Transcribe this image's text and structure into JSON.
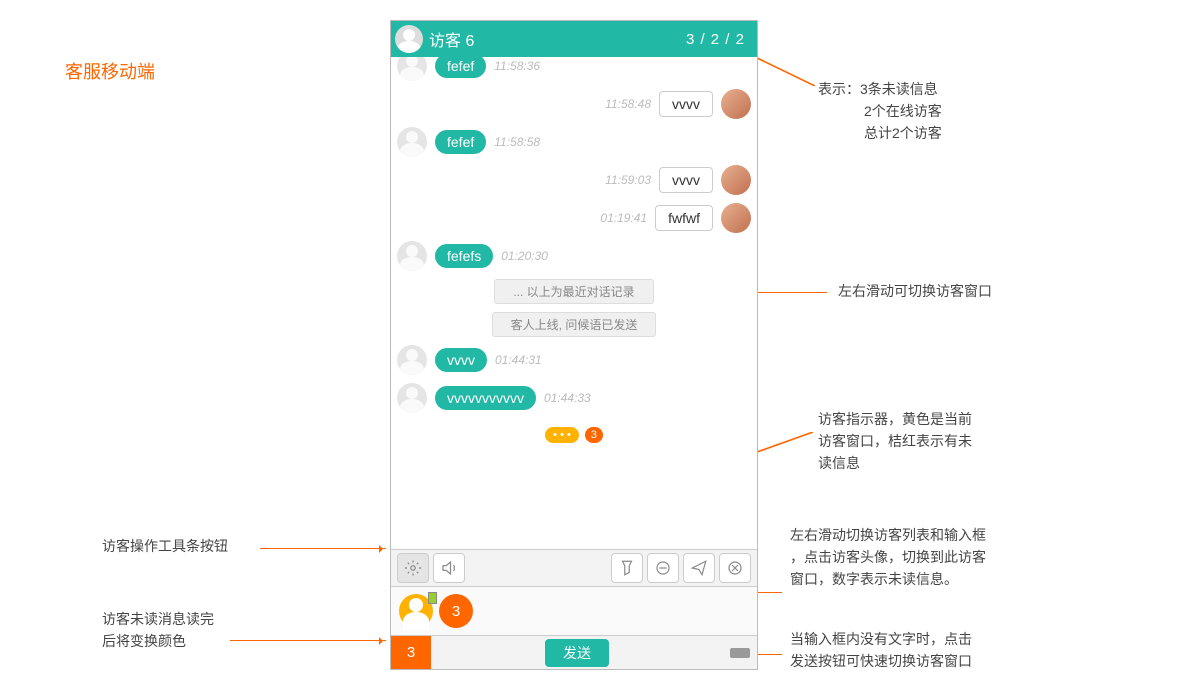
{
  "page_title": "客服移动端",
  "header": {
    "visitor_name": "访客 6",
    "counts": "3 / 2 / 2"
  },
  "messages": [
    {
      "side": "left",
      "text": "fefef",
      "ts": "11:58:36",
      "plain": false
    },
    {
      "side": "right",
      "text": "vvvv",
      "ts": "11:58:48",
      "plain": true
    },
    {
      "side": "left",
      "text": "fefef",
      "ts": "11:58:58",
      "plain": false
    },
    {
      "side": "right",
      "text": "vvvv",
      "ts": "11:59:03",
      "plain": true
    },
    {
      "side": "right",
      "text": "fwfwf",
      "ts": "01:19:41",
      "plain": true
    },
    {
      "side": "left",
      "text": "fefefs",
      "ts": "01:20:30",
      "plain": false
    },
    {
      "sys": "... 以上为最近对话记录"
    },
    {
      "sys": "客人上线, 问候语已发送"
    },
    {
      "side": "left",
      "text": "vvvv",
      "ts": "01:44:31",
      "plain": false
    },
    {
      "side": "left",
      "text": "vvvvvvvvvvv",
      "ts": "01:44:33",
      "plain": false
    }
  ],
  "indicator": {
    "dot": "• • •",
    "badge": "3"
  },
  "visitor_strip": {
    "orange_badge": "3"
  },
  "bottom": {
    "badge": "3",
    "send_label": "发送"
  },
  "annotations": {
    "counts_explain_l1": "表示：3条未读信息",
    "counts_explain_l2": "2个在线访客",
    "counts_explain_l3": "总计2个访客",
    "swipe": "左右滑动可切换访客窗口",
    "indicator_l1": "访客指示器，黄色是当前",
    "indicator_l2": "访客窗口，桔红表示有未",
    "indicator_l3": "读信息",
    "toolbar_label": "访客操作工具条按钮",
    "strip_l1": "左右滑动切换访客列表和输入框",
    "strip_l2": "，点击访客头像，切换到此访客",
    "strip_l3": "窗口，数字表示未读信息。",
    "bottom_left_l1": "访客未读消息读完",
    "bottom_left_l2": "后将变换颜色",
    "send_l1": "当输入框内没有文字时，点击",
    "send_l2": "发送按钮可快速切换访客窗口"
  }
}
